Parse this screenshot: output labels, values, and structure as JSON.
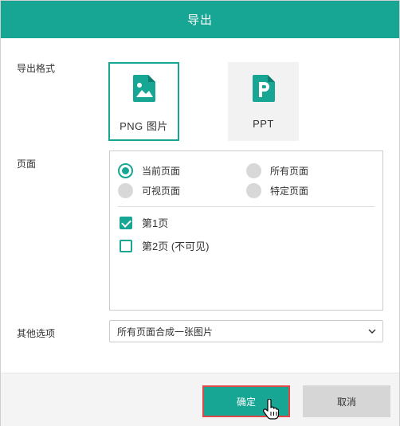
{
  "dialog": {
    "title": "导出"
  },
  "format": {
    "label": "导出格式",
    "options": [
      {
        "label": "PNG 图片",
        "icon": "image-file-icon",
        "selected": true
      },
      {
        "label": "PPT",
        "icon": "ppt-file-icon",
        "selected": false
      }
    ]
  },
  "pages": {
    "label": "页面",
    "radios": [
      {
        "label": "当前页面",
        "checked": true
      },
      {
        "label": "所有页面",
        "checked": false
      },
      {
        "label": "可视页面",
        "checked": false
      },
      {
        "label": "特定页面",
        "checked": false
      }
    ],
    "list": [
      {
        "label": "第1页",
        "checked": true
      },
      {
        "label": "第2页 (不可见)",
        "checked": false
      }
    ]
  },
  "other": {
    "label": "其他选项",
    "select_value": "所有页面合成一张图片"
  },
  "footer": {
    "ok_label": "确定",
    "cancel_label": "取消"
  },
  "colors": {
    "accent": "#17a594",
    "ok_border": "#e04848"
  }
}
